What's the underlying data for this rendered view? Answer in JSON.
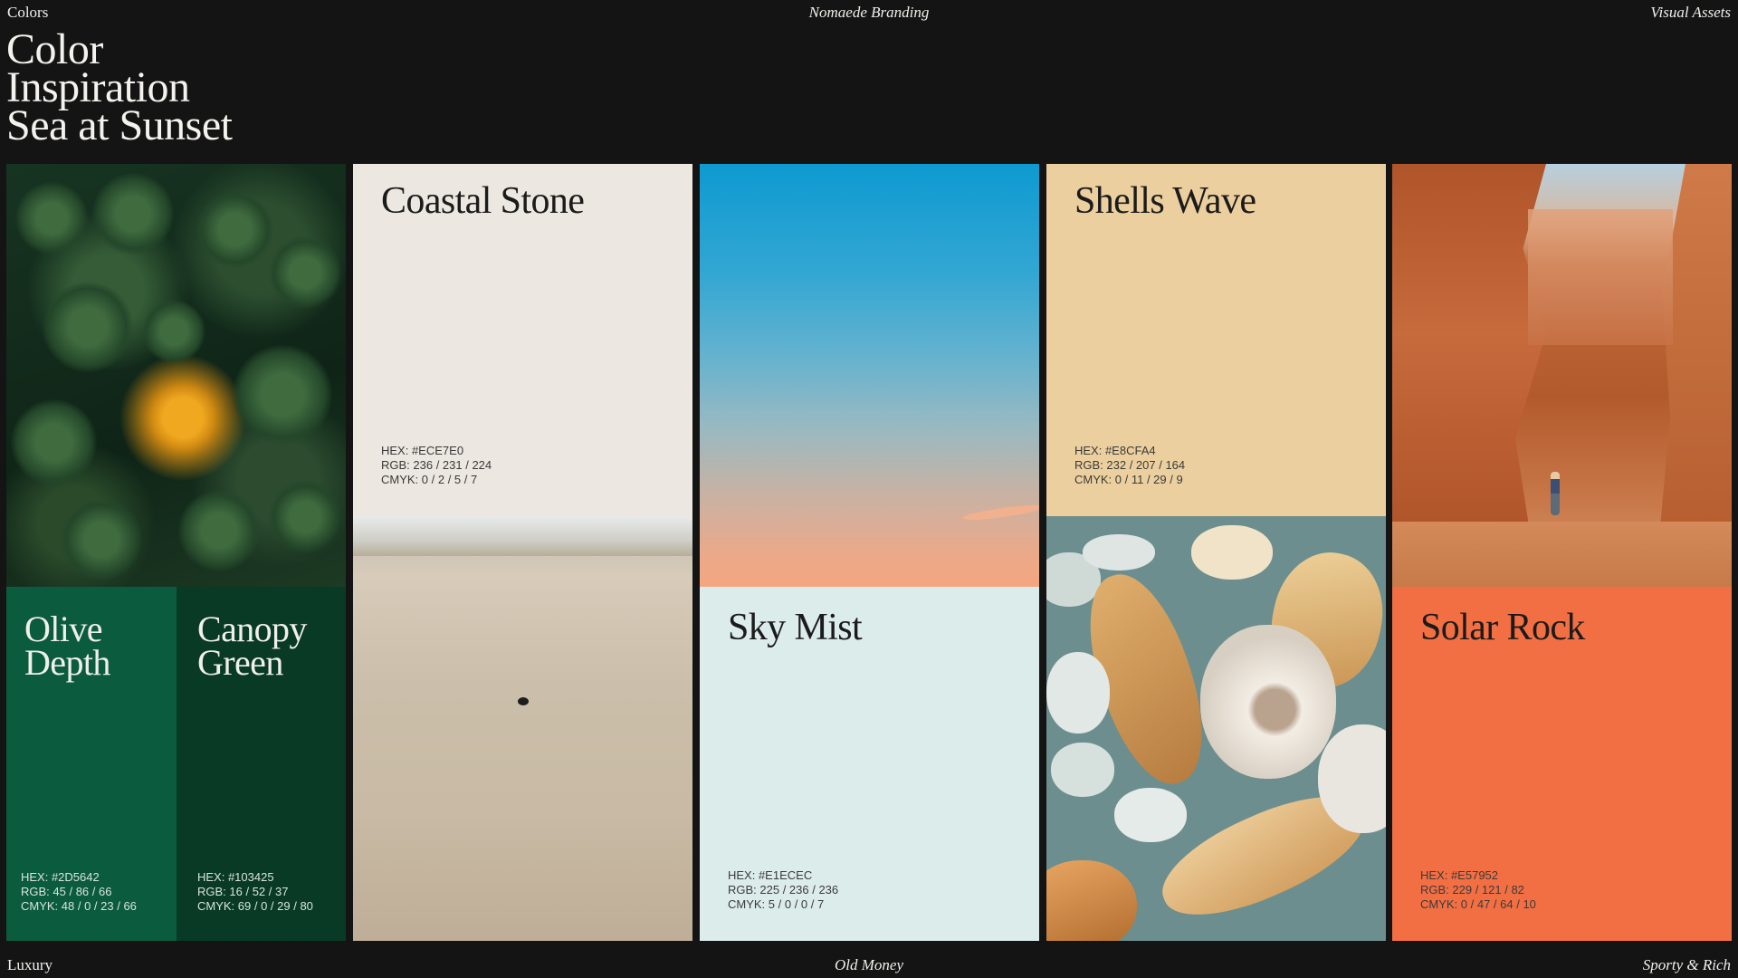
{
  "header": {
    "left": "Colors",
    "center": "Nomaede Branding",
    "right": "Visual Assets"
  },
  "footer": {
    "left": "Luxury",
    "center": "Old Money",
    "right": "Sporty & Rich"
  },
  "hero": {
    "line1": "Color",
    "line2": "Inspiration",
    "line3": "Sea at Sunset"
  },
  "swatches": [
    {
      "name_line1": "Olive",
      "name_line2": "Depth",
      "hex": "HEX: #2D5642",
      "rgb": "RGB: 45 / 86 / 66",
      "cmyk": "CMYK: 48 / 0 / 23 / 66",
      "color": "#0b5b3f"
    },
    {
      "name_line1": "Canopy",
      "name_line2": "Green",
      "hex": "HEX: #103425",
      "rgb": "RGB: 16 / 52 / 37",
      "cmyk": "CMYK: 69 / 0 / 29 / 80",
      "color": "#083a25"
    },
    {
      "name": "Coastal Stone",
      "hex": "HEX: #ECE7E0",
      "rgb": "RGB: 236 / 231 / 224",
      "cmyk": "CMYK: 0 / 2 / 5 / 7",
      "color": "#ECE7E0"
    },
    {
      "name": "Sky Mist",
      "hex": "HEX: #E1ECEC",
      "rgb": "RGB: 225 / 236 / 236",
      "cmyk": "CMYK: 5 / 0 / 0 / 7",
      "color": "#DCECEB"
    },
    {
      "name": "Shells Wave",
      "hex": "HEX: #E8CFA4",
      "rgb": "RGB: 232 / 207 / 164",
      "cmyk": "CMYK: 0 / 11 / 29 / 9",
      "color": "#ECCF9E"
    },
    {
      "name": "Solar Rock",
      "hex": "HEX: #E57952",
      "rgb": "RGB: 229 / 121 / 82",
      "cmyk": "CMYK: 0 / 47 / 64 / 10",
      "color": "#F26F44"
    }
  ],
  "icons": [
    "forest-photo-icon",
    "sand-photo-icon",
    "sky-photo-icon",
    "shells-photo-icon",
    "canyon-photo-icon"
  ]
}
